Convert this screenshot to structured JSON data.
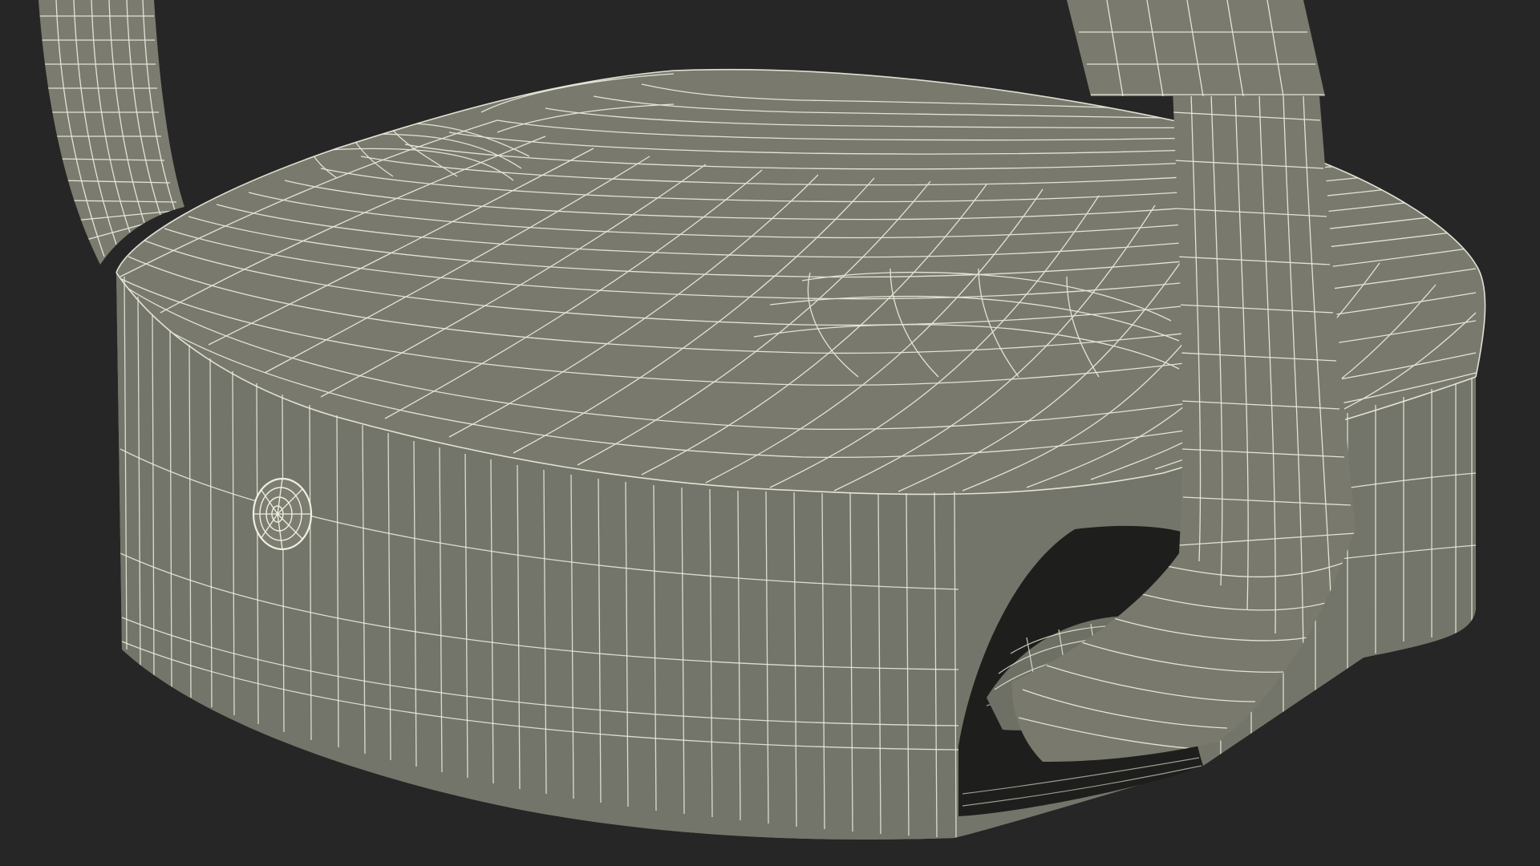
{
  "colors": {
    "background": "#262626",
    "surface": "#797a6d",
    "surface_shadow": "#5d5e54",
    "cavity": "#1e1f1c",
    "wire": "#eef0e0"
  }
}
